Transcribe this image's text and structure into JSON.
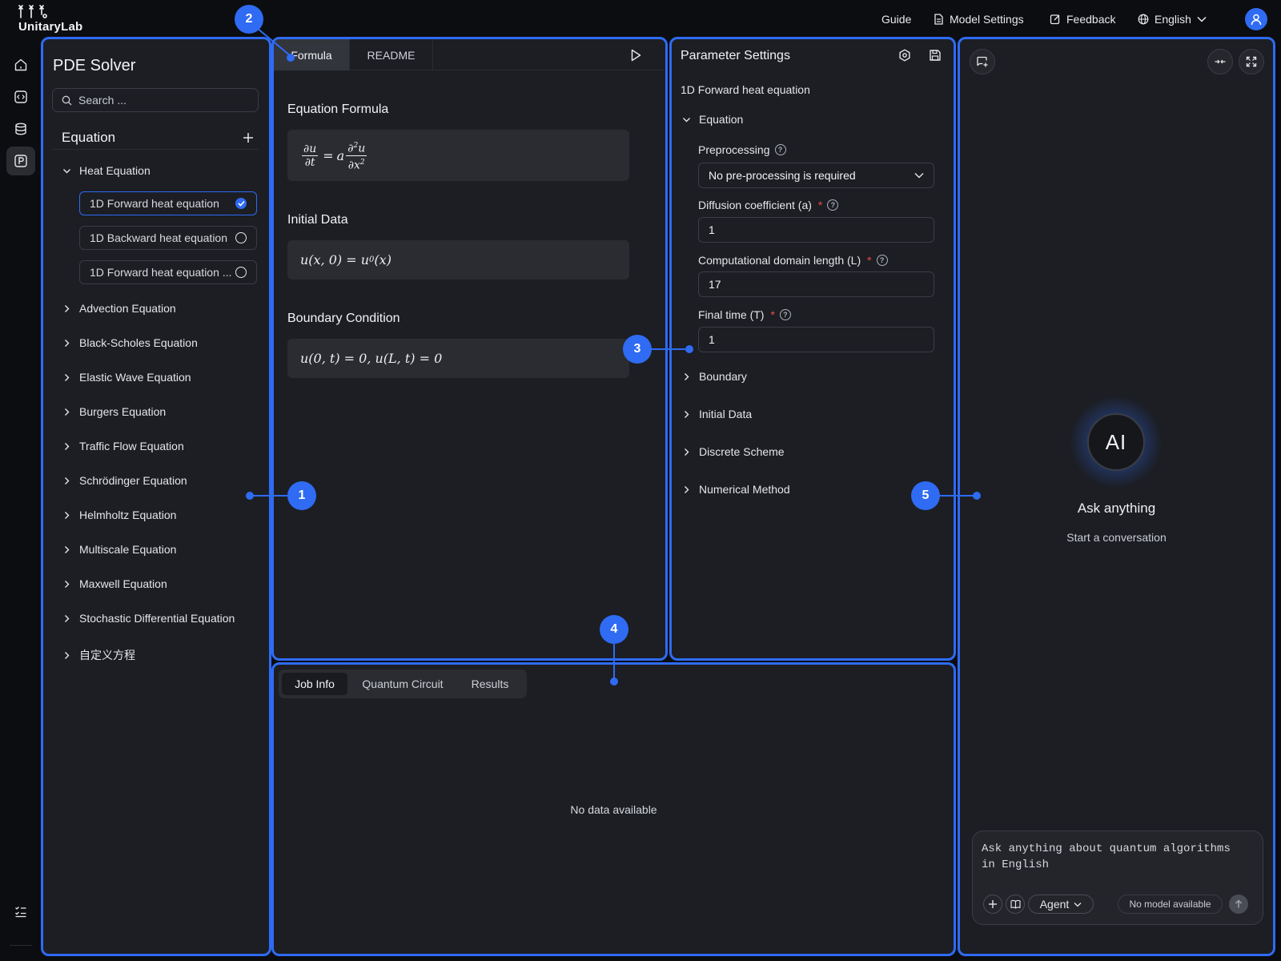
{
  "app": {
    "logo_text": "UnitaryLab"
  },
  "topbar": {
    "guide": "Guide",
    "model_settings": "Model Settings",
    "feedback": "Feedback",
    "language": "English"
  },
  "rail": {
    "icons": [
      "home-icon",
      "code-icon",
      "database-icon",
      "pde-solver-icon",
      "tasks-icon"
    ],
    "active": "pde-solver-icon"
  },
  "sidebar": {
    "title": "PDE Solver",
    "search_placeholder": "Search ...",
    "section_label": "Equation",
    "groups": [
      {
        "label": "Heat Equation",
        "expanded": true,
        "items": [
          {
            "label": "1D Forward heat equation",
            "selected": true
          },
          {
            "label": "1D Backward heat equation",
            "selected": false
          },
          {
            "label": "1D Forward heat equation ...",
            "selected": false
          }
        ]
      },
      {
        "label": "Advection Equation"
      },
      {
        "label": "Black-Scholes Equation"
      },
      {
        "label": "Elastic Wave Equation"
      },
      {
        "label": "Burgers Equation"
      },
      {
        "label": "Traffic Flow Equation"
      },
      {
        "label": "Schrödinger Equation"
      },
      {
        "label": "Helmholtz Equation"
      },
      {
        "label": "Multiscale Equation"
      },
      {
        "label": "Maxwell Equation"
      },
      {
        "label": "Stochastic Differential Equation"
      },
      {
        "label": "自定义方程"
      }
    ]
  },
  "editor": {
    "tabs": [
      "Formula",
      "README"
    ],
    "active_tab": "Formula",
    "sections": {
      "equation_title": "Equation Formula",
      "equation": {
        "lhs_num": "∂u",
        "lhs_den": "∂t",
        "eq": "=",
        "coef": "a",
        "rhs_num": "∂",
        "rhs_num_exp": "2",
        "rhs_num_var": "u",
        "rhs_den": "∂x",
        "rhs_den_exp": "2"
      },
      "initial_title": "Initial Data",
      "initial": {
        "lhs": "u(x, 0) = u",
        "sub": "0",
        "rhs": "(x)"
      },
      "boundary_title": "Boundary Condition",
      "boundary": "u(0, t) = 0, u(L, t) = 0"
    }
  },
  "params": {
    "title": "Parameter Settings",
    "subtitle": "1D Forward heat equation",
    "equation_group": "Equation",
    "fields": {
      "preprocessing_label": "Preprocessing",
      "preprocessing_value": "No pre-processing is required",
      "diffusion_label": "Diffusion coefficient (a)",
      "diffusion_value": "1",
      "domain_label": "Computational domain length (L)",
      "domain_value": "17",
      "final_time_label": "Final time (T)",
      "final_time_value": "1",
      "required_mark": "*",
      "help_glyph": "?"
    },
    "collapsed_groups": [
      "Boundary",
      "Initial Data",
      "Discrete Scheme",
      "Numerical Method"
    ]
  },
  "results": {
    "tabs": [
      "Job Info",
      "Quantum Circuit",
      "Results"
    ],
    "active_tab": "Job Info",
    "empty_text": "No data available"
  },
  "assistant": {
    "avatar_text": "AI",
    "title": "Ask anything",
    "subtitle": "Start a conversation",
    "input_placeholder": "Ask anything about quantum algorithms in English",
    "mode": "Agent",
    "model_status": "No model available"
  },
  "annotations": [
    "1",
    "2",
    "3",
    "4",
    "5"
  ],
  "colors": {
    "accent": "#2f6bf3",
    "panel_bg": "#1c1e24",
    "page_bg": "#0c0d10",
    "required": "#ef4b4b"
  }
}
